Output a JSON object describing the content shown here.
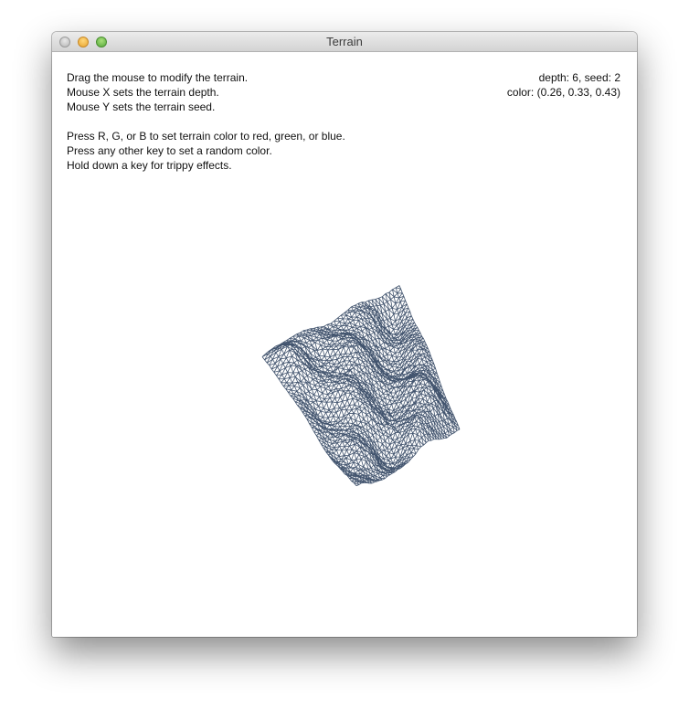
{
  "window": {
    "title": "Terrain"
  },
  "instructions": {
    "lines_top": [
      "Drag the mouse to modify the terrain.",
      "Mouse X sets the terrain depth.",
      "Mouse Y sets the terrain seed."
    ],
    "lines_bottom": [
      "Press R, G, or B to set terrain color to red, green, or blue.",
      "Press any other key to set a random color.",
      "Hold down a key for trippy effects."
    ]
  },
  "status": {
    "depth_seed": "depth: 6, seed: 2",
    "color": "color: (0.26, 0.33, 0.43)"
  },
  "terrain": {
    "depth": 6,
    "seed": 2,
    "color_hex": "#42546e",
    "rgb": [
      0.26,
      0.33,
      0.43
    ]
  }
}
